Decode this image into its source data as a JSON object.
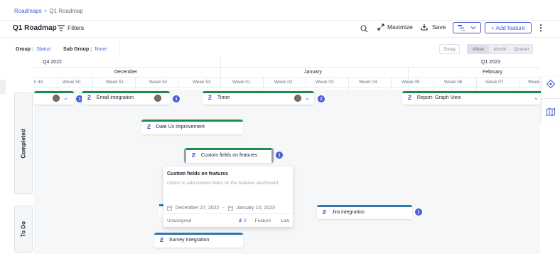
{
  "breadcrumb": {
    "root": "Roadmaps",
    "separator": ">",
    "current": "Q1 Roadmap"
  },
  "header": {
    "title": "Q1 Roadmap",
    "filters_label": "Filters",
    "maximize_label": "Maximize",
    "save_label": "Save",
    "add_feature_label": "+ Add feature"
  },
  "grouping": {
    "group_label": "Group :",
    "group_value": "Status",
    "subgroup_label": "Sub Group :",
    "subgroup_value": "None"
  },
  "zoom": {
    "today": "Today",
    "options": [
      "Week",
      "Month",
      "Quarter"
    ],
    "active": "Week"
  },
  "timeline": {
    "quarters": [
      "Q4 2022",
      "Q1 2023"
    ],
    "months": [
      "December",
      "January",
      "February"
    ],
    "weeks": [
      "k 49",
      "Week 50",
      "Week 51",
      "Week 52",
      "Week 53",
      "Week 01",
      "Week 02",
      "Week 03",
      "Week 04",
      "Week 05",
      "Week 06",
      "Week 07",
      "Week 08"
    ]
  },
  "lanes": [
    "Completed",
    "To Do"
  ],
  "features": [
    {
      "name": "",
      "badge": "1"
    },
    {
      "name": "Email integration",
      "badge": "1"
    },
    {
      "name": "Timer",
      "badge": "2"
    },
    {
      "name": "Report- Graph View",
      "badge": ""
    },
    {
      "name": "Date Ux Improvement",
      "badge": ""
    },
    {
      "name": "Custom fields on features",
      "badge": "1"
    },
    {
      "name": "Jira integration",
      "badge": "1"
    },
    {
      "name": "Survey integration",
      "badge": ""
    }
  ],
  "popup": {
    "title": "Custom fields on features",
    "description": "Option to add custom fields on the features dashboard",
    "start_date": "December 27, 2022",
    "date_separator": "-",
    "end_date": "January 10, 2023",
    "assignee": "Unassigned",
    "count": "0",
    "type": "Feature",
    "priority": "Low"
  },
  "colors": {
    "accent": "#4a5bd4",
    "completed_bar": "#1f8a4c",
    "todo_bar": "#2a7ab0",
    "neutral_bar": "#9aa0ab"
  },
  "icons": [
    "search-icon",
    "filter-icon",
    "maximize-icon",
    "save-icon",
    "feature-z-icon",
    "avatar",
    "chevron-down-icon",
    "kebab-icon",
    "roadmap-view-icon",
    "book-icon",
    "calendar-icon"
  ]
}
